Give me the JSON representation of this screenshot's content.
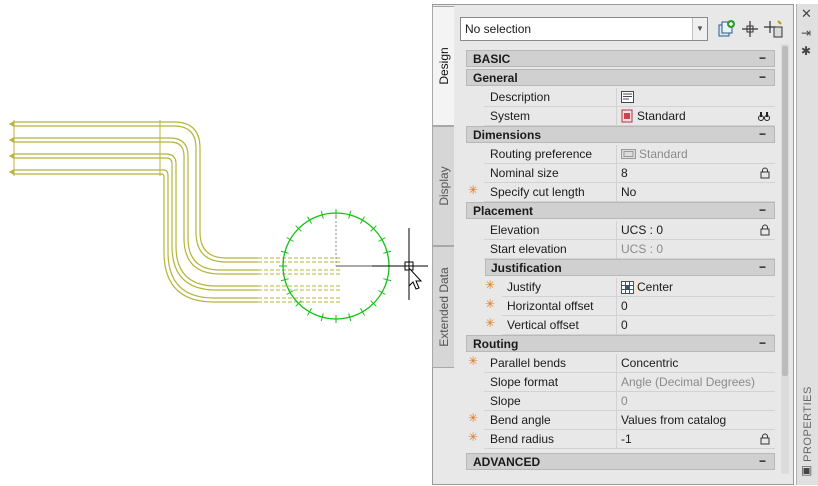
{
  "palette": {
    "tabs": [
      "Design",
      "Display",
      "Extended Data"
    ],
    "title": "PROPERTIES",
    "selection": "No selection"
  },
  "sections": {
    "basic": "BASIC",
    "general": "General",
    "dimensions": "Dimensions",
    "placement": "Placement",
    "justification": "Justification",
    "routing": "Routing",
    "advanced": "ADVANCED",
    "collapse_glyph": "−"
  },
  "rows": {
    "description": {
      "label": "Description",
      "value": ""
    },
    "system": {
      "label": "System",
      "value": "Standard"
    },
    "routing_preference": {
      "label": "Routing preference",
      "value": "Standard"
    },
    "nominal_size": {
      "label": "Nominal size",
      "value": "8"
    },
    "specify_cut_length": {
      "label": "Specify cut length",
      "value": "No"
    },
    "elevation": {
      "label": "Elevation",
      "value": "UCS : 0"
    },
    "start_elevation": {
      "label": "Start elevation",
      "value": "UCS : 0"
    },
    "justify": {
      "label": "Justify",
      "value": "Center"
    },
    "horizontal_offset": {
      "label": "Horizontal offset",
      "value": "0"
    },
    "vertical_offset": {
      "label": "Vertical offset",
      "value": "0"
    },
    "parallel_bends": {
      "label": "Parallel bends",
      "value": "Concentric"
    },
    "slope_format": {
      "label": "Slope format",
      "value": "Angle (Decimal Degrees)"
    },
    "slope": {
      "label": "Slope",
      "value": "0"
    },
    "bend_angle": {
      "label": "Bend angle",
      "value": "Values from catalog"
    },
    "bend_radius": {
      "label": "Bend radius",
      "value": "-1"
    }
  },
  "star_glyph": "✳",
  "colors": {
    "pipe": "#b5b53a",
    "snap_circle": "#16c016",
    "required_star": "#e07820"
  },
  "icons": {
    "toolbar": [
      "select-objects-icon",
      "quick-select-icon",
      "toggle-pickadd-icon"
    ],
    "titlebar": [
      "close-icon",
      "auto-hide-icon",
      "settings-icon"
    ]
  }
}
